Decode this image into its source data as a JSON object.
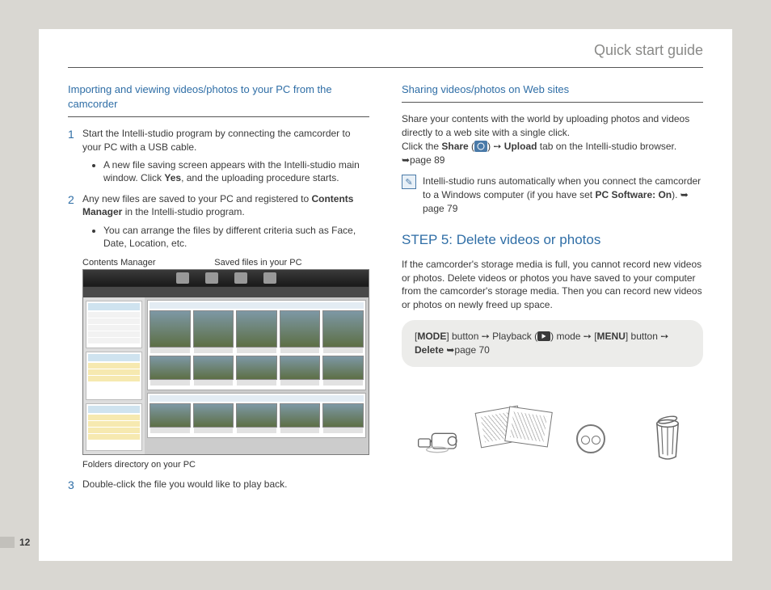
{
  "header": {
    "title": "Quick start guide"
  },
  "page_number": "12",
  "left": {
    "section_title": "Importing and viewing videos/photos to your PC from the camcorder",
    "steps": {
      "s1": {
        "num": "1",
        "text": "Start the Intelli-studio program by connecting the camcorder to your PC with a USB cable.",
        "bullet_a": "A new file saving screen appears with the Intelli-studio main window. Click ",
        "bullet_a_bold": "Yes",
        "bullet_a_tail": ", and the uploading procedure starts."
      },
      "s2": {
        "num": "2",
        "text_a": "Any new files are saved to your PC and registered to ",
        "text_bold": "Contents Manager",
        "text_b": " in the Intelli-studio program.",
        "bullet": "You can arrange the files by different criteria such as Face, Date, Location, etc."
      },
      "s3": {
        "num": "3",
        "text": "Double-click the file you would like to play back."
      }
    },
    "labels": {
      "contents_manager": "Contents Manager",
      "saved_files": "Saved files in your PC",
      "folders_dir": "Folders directory on your PC"
    }
  },
  "right": {
    "section_title": "Sharing videos/photos on Web sites",
    "para1": "Share your contents with the world by uploading photos and videos directly to a web site with a single click.",
    "para2_a": "Click the ",
    "para2_share": "Share",
    "para2_b": " (",
    "para2_c": ") ➙ ",
    "para2_upload": "Upload",
    "para2_d": " tab on the Intelli-studio browser. ➥page 89",
    "note_a": "Intelli-studio runs automatically when you connect the camcorder to a Windows computer (if you have set ",
    "note_bold": "PC Software: On",
    "note_b": "). ➥ page 79",
    "step5_title": "STEP 5: Delete videos or photos",
    "step5_para": "If the camcorder's storage media is full, you cannot record new videos or photos. Delete videos or photos you have saved to your computer from the camcorder's storage media. Then you can record new videos or photos on newly freed up space.",
    "callout": {
      "a": "[",
      "mode": "MODE",
      "b": "] button ➙ Playback (",
      "c": ") mode ➙ [",
      "menu": "MENU",
      "d": "] button ➙ ",
      "delete": "Delete",
      "e": " ➥page 70"
    }
  }
}
